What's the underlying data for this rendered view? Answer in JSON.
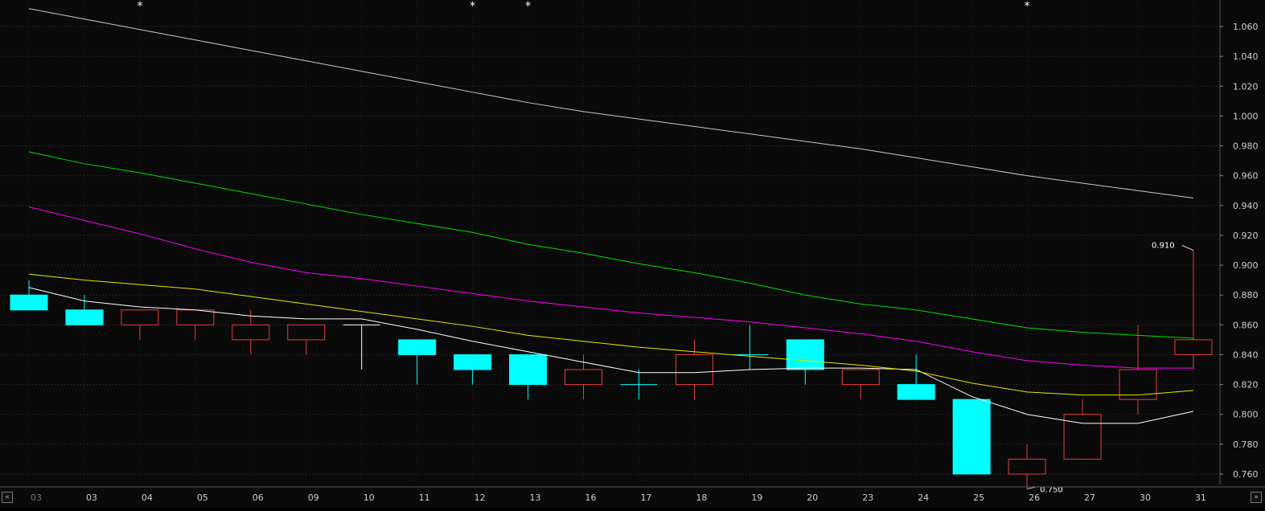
{
  "chart_data": {
    "type": "candlestick",
    "title": "",
    "xlabel": "",
    "ylabel": "",
    "ylim": [
      0.75,
      1.075
    ],
    "y_ticks": [
      "1.060",
      "1.040",
      "1.020",
      "1.000",
      "0.980",
      "0.960",
      "0.940",
      "0.920",
      "0.900",
      "0.880",
      "0.860",
      "0.840",
      "0.820",
      "0.800",
      "0.780",
      "0.760"
    ],
    "categories": [
      "03",
      "03",
      "04",
      "05",
      "06",
      "09",
      "10",
      "11",
      "12",
      "13",
      "16",
      "17",
      "18",
      "19",
      "20",
      "23",
      "24",
      "25",
      "26",
      "27",
      "30",
      "31"
    ],
    "candles": [
      {
        "open": 0.88,
        "high": 0.89,
        "low": 0.87,
        "close": 0.87
      },
      {
        "open": 0.87,
        "high": 0.88,
        "low": 0.86,
        "close": 0.86
      },
      {
        "open": 0.86,
        "high": 0.87,
        "low": 0.85,
        "close": 0.87
      },
      {
        "open": 0.86,
        "high": 0.87,
        "low": 0.85,
        "close": 0.87
      },
      {
        "open": 0.85,
        "high": 0.87,
        "low": 0.84,
        "close": 0.86
      },
      {
        "open": 0.85,
        "high": 0.86,
        "low": 0.84,
        "close": 0.86
      },
      {
        "open": 0.86,
        "high": 0.86,
        "low": 0.83,
        "close": 0.86
      },
      {
        "open": 0.85,
        "high": 0.85,
        "low": 0.82,
        "close": 0.84
      },
      {
        "open": 0.84,
        "high": 0.84,
        "low": 0.82,
        "close": 0.83
      },
      {
        "open": 0.84,
        "high": 0.84,
        "low": 0.81,
        "close": 0.82
      },
      {
        "open": 0.82,
        "high": 0.84,
        "low": 0.81,
        "close": 0.83
      },
      {
        "open": 0.82,
        "high": 0.83,
        "low": 0.81,
        "close": 0.82
      },
      {
        "open": 0.82,
        "high": 0.85,
        "low": 0.81,
        "close": 0.84
      },
      {
        "open": 0.84,
        "high": 0.86,
        "low": 0.83,
        "close": 0.84
      },
      {
        "open": 0.85,
        "high": 0.85,
        "low": 0.82,
        "close": 0.83
      },
      {
        "open": 0.82,
        "high": 0.83,
        "low": 0.81,
        "close": 0.83
      },
      {
        "open": 0.82,
        "high": 0.84,
        "low": 0.81,
        "close": 0.81
      },
      {
        "open": 0.81,
        "high": 0.81,
        "low": 0.76,
        "close": 0.76
      },
      {
        "open": 0.76,
        "high": 0.78,
        "low": 0.75,
        "close": 0.77
      },
      {
        "open": 0.77,
        "high": 0.81,
        "low": 0.77,
        "close": 0.8
      },
      {
        "open": 0.81,
        "high": 0.86,
        "low": 0.8,
        "close": 0.83
      },
      {
        "open": 0.84,
        "high": 0.91,
        "low": 0.83,
        "close": 0.85
      }
    ],
    "series": [
      {
        "color": "#ffffff",
        "values": [
          0.885,
          0.876,
          0.872,
          0.87,
          0.866,
          0.864,
          0.864,
          0.857,
          0.849,
          0.842,
          0.835,
          0.828,
          0.828,
          0.83,
          0.831,
          0.831,
          0.83,
          0.812,
          0.8,
          0.794,
          0.794,
          0.802
        ]
      },
      {
        "color": "#e6e600",
        "values": [
          0.894,
          0.89,
          0.887,
          0.884,
          0.879,
          0.874,
          0.869,
          0.864,
          0.859,
          0.853,
          0.849,
          0.845,
          0.842,
          0.839,
          0.836,
          0.833,
          0.829,
          0.821,
          0.815,
          0.813,
          0.813,
          0.816
        ]
      },
      {
        "color": "#ff00ff",
        "values": [
          0.939,
          0.93,
          0.921,
          0.911,
          0.902,
          0.895,
          0.891,
          0.886,
          0.881,
          0.876,
          0.872,
          0.868,
          0.865,
          0.862,
          0.858,
          0.854,
          0.849,
          0.842,
          0.836,
          0.833,
          0.831,
          0.831
        ]
      },
      {
        "color": "#00e000",
        "values": [
          0.976,
          0.968,
          0.962,
          0.955,
          0.948,
          0.941,
          0.934,
          0.928,
          0.922,
          0.914,
          0.908,
          0.901,
          0.895,
          0.888,
          0.88,
          0.874,
          0.87,
          0.864,
          0.858,
          0.855,
          0.853,
          0.851
        ]
      },
      {
        "color": "#c8c8c8",
        "values": [
          1.072,
          1.065,
          1.058,
          1.051,
          1.044,
          1.037,
          1.03,
          1.023,
          1.016,
          1.009,
          1.003,
          0.998,
          0.993,
          0.988,
          0.983,
          0.978,
          0.972,
          0.966,
          0.96,
          0.955,
          0.95,
          0.945
        ]
      }
    ],
    "event_markers": [
      1,
      7,
      8,
      17
    ],
    "event_marker_symbol": "*",
    "annotations": [
      {
        "text": "0.910",
        "candle": 21,
        "value": 0.91,
        "side": "left"
      },
      {
        "text": "0.750",
        "candle": 18,
        "value": 0.75,
        "side": "right"
      }
    ],
    "colors": {
      "background": "#0a0a0a",
      "up": "#e8403a",
      "down": "#00ffff",
      "grid": "#3a3a3a",
      "axis_text": "#d0d0d0",
      "first_label": "#7a7a7a"
    },
    "grid": true
  },
  "nav": {
    "scroll_left_icon": "«",
    "scroll_right_icon": "»"
  }
}
